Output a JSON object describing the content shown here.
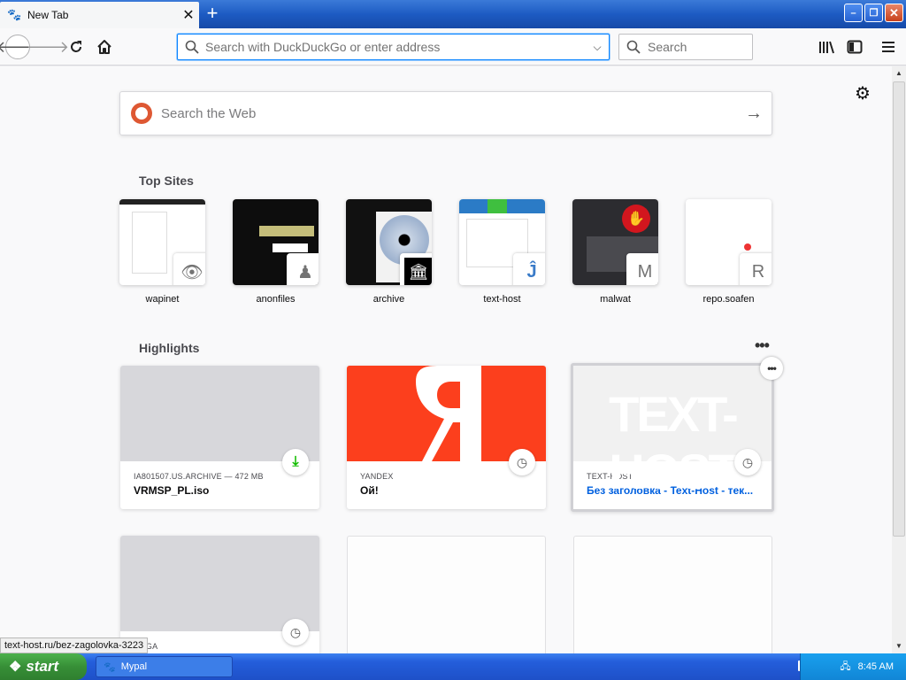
{
  "tab": {
    "title": "New Tab",
    "close": "✕",
    "new_tab": "+"
  },
  "window_controls": {
    "minimize": "–",
    "restore": "❐",
    "close": "✕"
  },
  "urlbar": {
    "placeholder": "Search with DuckDuckGo or enter address"
  },
  "searchbar": {
    "placeholder": "Search"
  },
  "websearch": {
    "placeholder": "Search the Web"
  },
  "top_sites": {
    "title": "Top Sites",
    "items": [
      {
        "label": "wapinet",
        "fav": ""
      },
      {
        "label": "anonfiles",
        "fav": ""
      },
      {
        "label": "archive",
        "fav": ""
      },
      {
        "label": "text-host",
        "fav": ""
      },
      {
        "label": "malwat",
        "fav": "M"
      },
      {
        "label": "repo.soafen",
        "fav": "R"
      }
    ]
  },
  "highlights": {
    "title": "Highlights",
    "cards": [
      {
        "source": "IA801507.US.ARCHIVE — 472 MB",
        "title": "VRMSP_PL.iso"
      },
      {
        "source": "YANDEX",
        "title": "Ой!"
      },
      {
        "source": "TEXT-HOST",
        "title": "Без заголовка - Text-Host - тек..."
      },
      {
        "source": "MEGA",
        "title": ""
      }
    ]
  },
  "status_url": "text-host.ru/bez-zagolovka-3223",
  "taskbar": {
    "start": "start",
    "item": "Mypal",
    "clock": "8:45 AM"
  },
  "colors": {
    "accent": "#0a84ff",
    "yandex": "#fc3f1d",
    "taskbar": "#245edb",
    "start": "#378f37"
  }
}
